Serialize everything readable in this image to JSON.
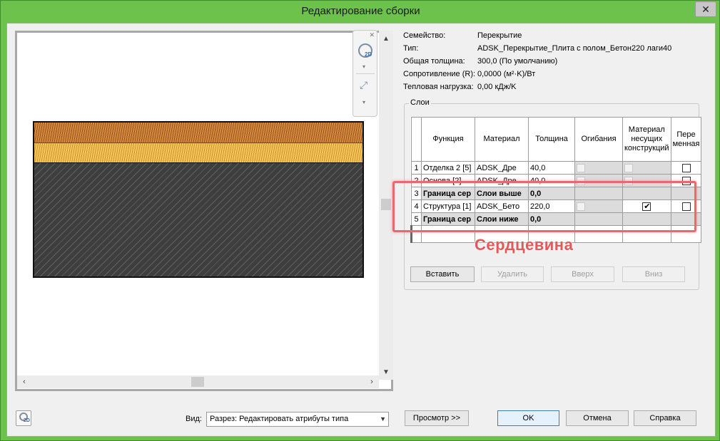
{
  "window": {
    "title": "Редактирование сборки",
    "close_glyph": "✕"
  },
  "properties": [
    {
      "label": "Семейство:",
      "value": "Перекрытие"
    },
    {
      "label": "Тип:",
      "value": "ADSK_Перекрытие_Плита с полом_Бетон220 лаги40"
    },
    {
      "label": "Общая толщина:",
      "value": "300,0 (По умолчанию)"
    },
    {
      "label": "Сопротивление (R):",
      "value": "0,0000 (м²·K)/Вт"
    },
    {
      "label": "Тепловая нагрузка:",
      "value": "0,00 кДж/K"
    }
  ],
  "layers_group": {
    "title": "Слои",
    "headers": {
      "function": "Функция",
      "material": "Материал",
      "thickness": "Толщина",
      "wraps": "Огибания",
      "structural": "Материал несущих конструкций",
      "variable": "Пере менная"
    },
    "rows": [
      {
        "num": "1",
        "function": "Отделка 2 [5]",
        "material": "ADSK_Дре",
        "thickness": "40,0",
        "boundary": false,
        "structural": false,
        "variable": false
      },
      {
        "num": "2",
        "function": "Основа [2]",
        "material": "ADSK_Дре",
        "thickness": "40,0",
        "boundary": false,
        "structural": false,
        "variable": false
      },
      {
        "num": "3",
        "function": "Граница сер",
        "material": "Слои выше",
        "thickness": "0,0",
        "boundary": true
      },
      {
        "num": "4",
        "function": "Структура [1]",
        "material": "ADSK_Бето",
        "thickness": "220,0",
        "boundary": false,
        "structural": true,
        "variable": false
      },
      {
        "num": "5",
        "function": "Граница сер",
        "material": "Слои ниже",
        "thickness": "0,0",
        "boundary": true
      }
    ]
  },
  "annotation": {
    "text": "Сердцевина",
    "color": "#e35858"
  },
  "buttons": {
    "insert": "Вставить",
    "delete": "Удалить",
    "up": "Вверх",
    "down": "Вниз",
    "preview": "Просмотр >>",
    "ok": "OK",
    "cancel": "Отмена",
    "help": "Справка"
  },
  "view": {
    "label": "Вид:",
    "value": "Разрез: Редактировать атрибуты типа"
  },
  "navbar": {
    "wheel_tag": "2D",
    "close": "✕"
  },
  "colors": {
    "finish_layer": "#d78a3f",
    "base_layer": "#f7c45a",
    "structure_layer": "#3e3e3e",
    "window_frame": "#6cc24a"
  }
}
